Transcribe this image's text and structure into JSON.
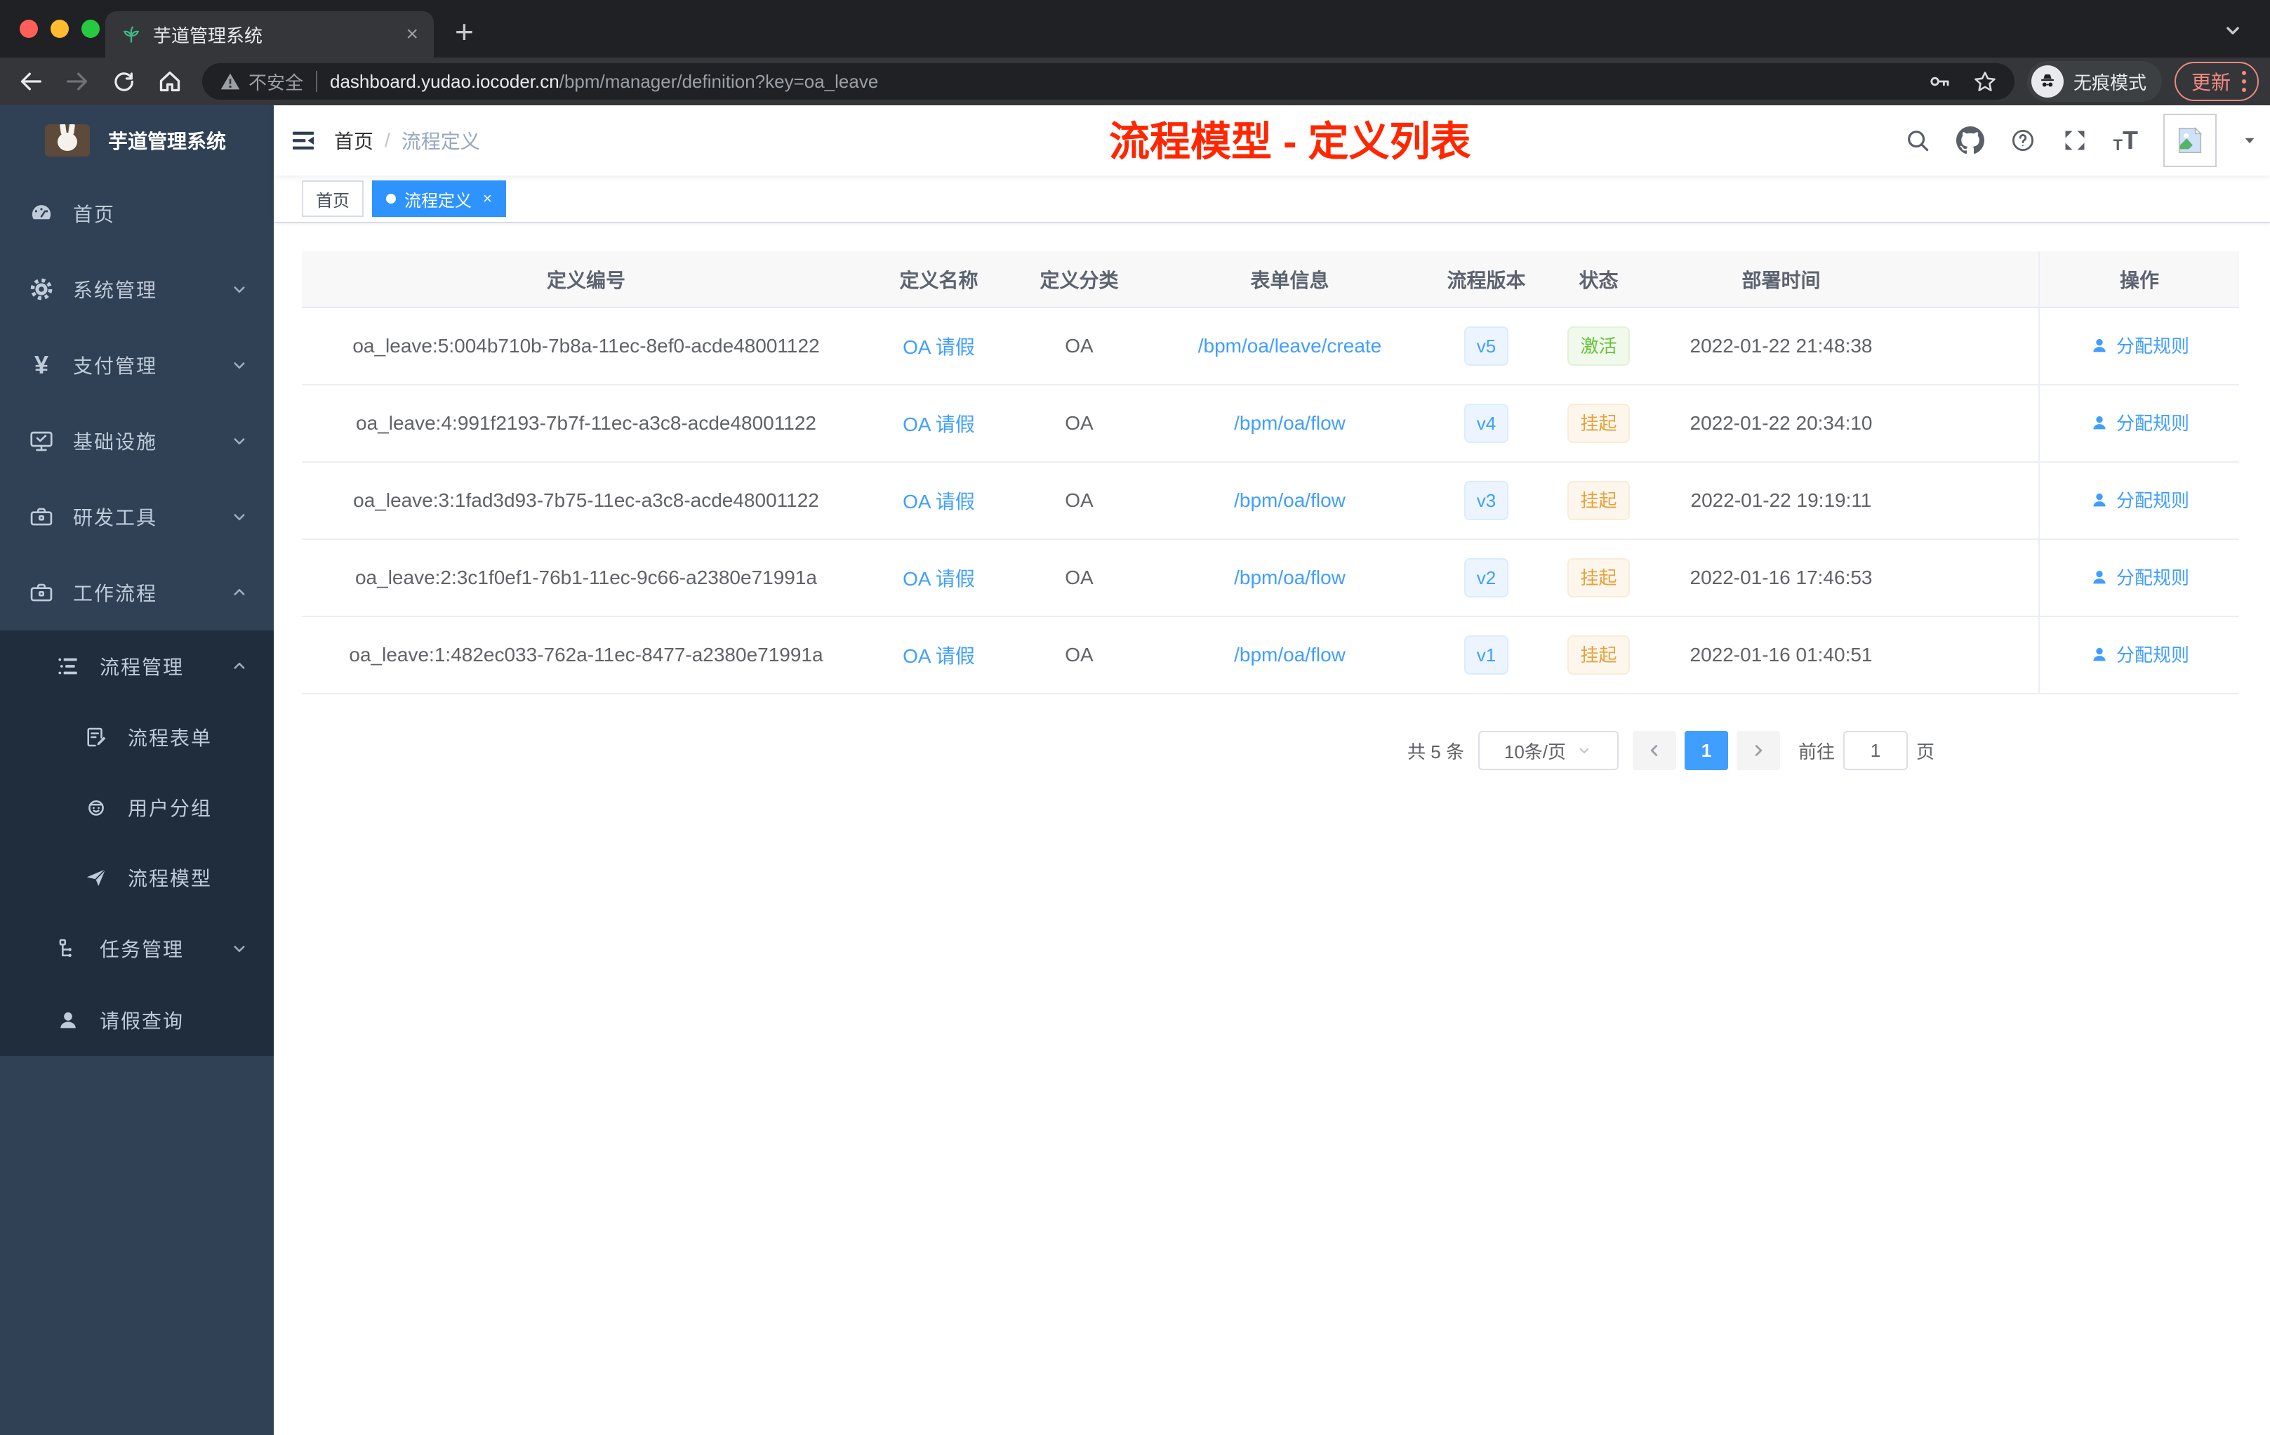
{
  "colors": {
    "accent": "#409EFF",
    "success": "#67C23A",
    "warning": "#E6A23C",
    "title_red": "#FF2600",
    "sidebar_bg": "#304156",
    "submenu_bg": "#1F2D3D",
    "sidebar_text": "#BFCBD9"
  },
  "browser": {
    "tab_title": "芋道管理系统",
    "close_tab": "×",
    "new_tab": "+",
    "not_secure": "不安全",
    "url_host": "dashboard.yudao.iocoder.cn",
    "url_path": "/bpm/manager/definition?key=oa_leave",
    "incognito_label": "无痕模式",
    "update_label": "更新"
  },
  "sidebar": {
    "logo_title": "芋道管理系统",
    "items": [
      {
        "label": "首页"
      },
      {
        "label": "系统管理"
      },
      {
        "label": "支付管理"
      },
      {
        "label": "基础设施"
      },
      {
        "label": "研发工具"
      },
      {
        "label": "工作流程"
      },
      {
        "label": "流程管理"
      },
      {
        "label": "流程表单"
      },
      {
        "label": "用户分组"
      },
      {
        "label": "流程模型"
      },
      {
        "label": "任务管理"
      },
      {
        "label": "请假查询"
      }
    ]
  },
  "navbar": {
    "breadcrumb_home": "首页",
    "breadcrumb_sep": "/",
    "breadcrumb_current": "流程定义",
    "overlay_title": "流程模型 - 定义列表"
  },
  "tags": {
    "home": "首页",
    "active": "流程定义",
    "close": "×"
  },
  "table": {
    "columns": [
      "定义编号",
      "定义名称",
      "定义分类",
      "表单信息",
      "流程版本",
      "状态",
      "部署时间",
      "操作"
    ],
    "rows": [
      {
        "id": "oa_leave:5:004b710b-7b8a-11ec-8ef0-acde48001122",
        "name": "OA 请假",
        "category": "OA",
        "form": "/bpm/oa/leave/create",
        "version": "v5",
        "status": "激活",
        "time": "2022-01-22 21:48:38",
        "action": "分配规则"
      },
      {
        "id": "oa_leave:4:991f2193-7b7f-11ec-a3c8-acde48001122",
        "name": "OA 请假",
        "category": "OA",
        "form": "/bpm/oa/flow",
        "version": "v4",
        "status": "挂起",
        "time": "2022-01-22 20:34:10",
        "action": "分配规则"
      },
      {
        "id": "oa_leave:3:1fad3d93-7b75-11ec-a3c8-acde48001122",
        "name": "OA 请假",
        "category": "OA",
        "form": "/bpm/oa/flow",
        "version": "v3",
        "status": "挂起",
        "time": "2022-01-22 19:19:11",
        "action": "分配规则"
      },
      {
        "id": "oa_leave:2:3c1f0ef1-76b1-11ec-9c66-a2380e71991a",
        "name": "OA 请假",
        "category": "OA",
        "form": "/bpm/oa/flow",
        "version": "v2",
        "status": "挂起",
        "time": "2022-01-16 17:46:53",
        "action": "分配规则"
      },
      {
        "id": "oa_leave:1:482ec033-762a-11ec-8477-a2380e71991a",
        "name": "OA 请假",
        "category": "OA",
        "form": "/bpm/oa/flow",
        "version": "v1",
        "status": "挂起",
        "time": "2022-01-16 01:40:51",
        "action": "分配规则"
      }
    ]
  },
  "pagination": {
    "total": "共 5 条",
    "page_size": "10条/页",
    "current": "1",
    "goto": "前往",
    "page_input": "1",
    "unit": "页"
  }
}
